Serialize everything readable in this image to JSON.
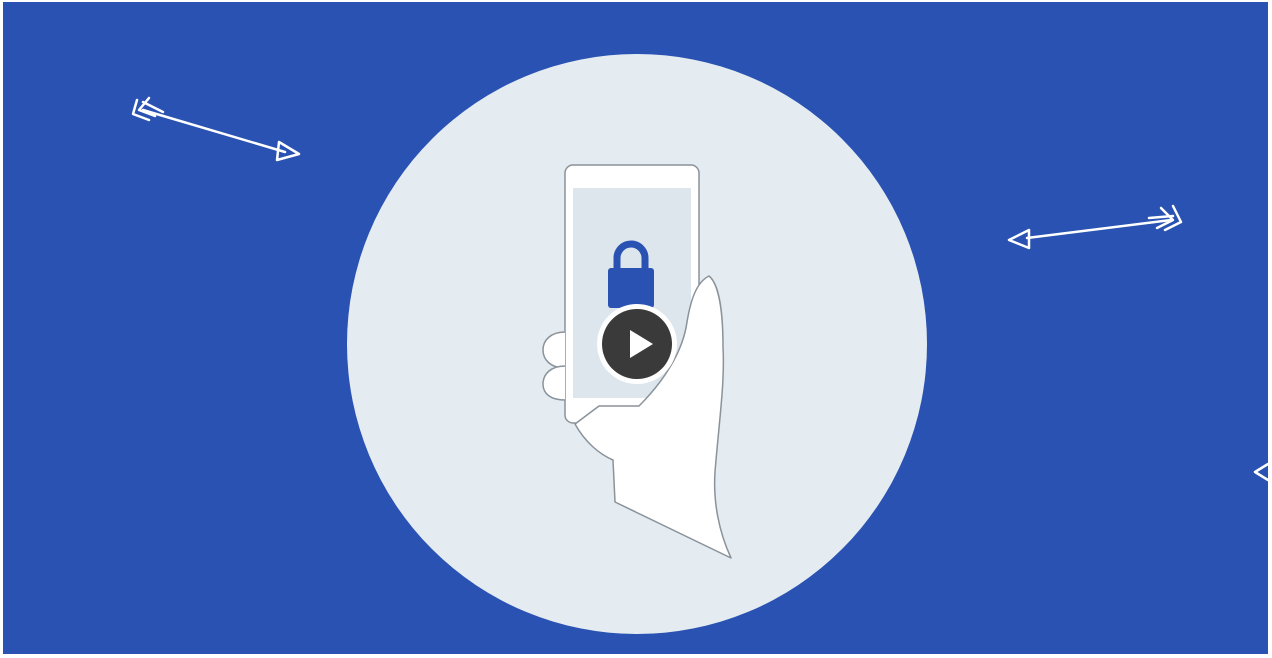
{
  "video": {
    "thumbnail_icon": "phone-lock-illustration",
    "play_icon": "play-icon",
    "colors": {
      "background": "#2a52b3",
      "circle": "#e4ecf2",
      "screen": "#dde6ed",
      "lock": "#2a52b3",
      "play_fill": "#3a3a3a",
      "arrow_stroke": "#ffffff"
    }
  }
}
